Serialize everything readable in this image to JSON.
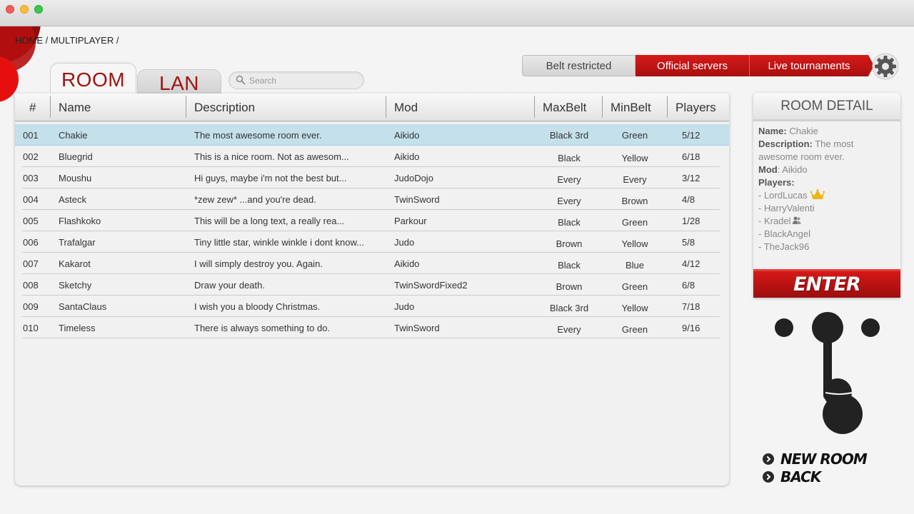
{
  "window": {
    "controls": [
      "close",
      "minimize",
      "zoom"
    ]
  },
  "breadcrumb": "HOME / MULTIPLAYER /",
  "tabs": {
    "room": "ROOM",
    "lan": "LAN"
  },
  "search": {
    "placeholder": "Search",
    "value": ""
  },
  "filters": {
    "belt": "Belt restricted",
    "official": "Official servers",
    "live": "Live tournaments"
  },
  "table": {
    "headers": {
      "num": "#",
      "name": "Name",
      "desc": "Description",
      "mod": "Mod",
      "max": "MaxBelt",
      "min": "MinBelt",
      "players": "Players"
    },
    "rows": [
      {
        "num": "001",
        "name": "Chakie",
        "desc": "The most awesome room ever.",
        "mod": "Aikido",
        "max": "Black 3rd",
        "min": "Green",
        "players": "5/12"
      },
      {
        "num": "002",
        "name": "Bluegrid",
        "desc": "This is a nice room. Not as awesom...",
        "mod": "Aikido",
        "max": "Black",
        "min": "Yellow",
        "players": "6/18"
      },
      {
        "num": "003",
        "name": "Moushu",
        "desc": "Hi guys, maybe i'm not the best but...",
        "mod": "JudoDojo",
        "max": "Every",
        "min": "Every",
        "players": "3/12"
      },
      {
        "num": "004",
        "name": "Asteck",
        "desc": "*zew zew* ...and you're dead.",
        "mod": "TwinSword",
        "max": "Every",
        "min": "Brown",
        "players": "4/8"
      },
      {
        "num": "005",
        "name": "Flashkoko",
        "desc": "This will be a long text, a really rea...",
        "mod": "Parkour",
        "max": "Black",
        "min": "Green",
        "players": "1/28"
      },
      {
        "num": "006",
        "name": "Trafalgar",
        "desc": "Tiny little star, winkle winkle i dont know...",
        "mod": "Judo",
        "max": "Brown",
        "min": "Yellow",
        "players": "5/8"
      },
      {
        "num": "007",
        "name": "Kakarot",
        "desc": "I will simply destroy you. Again.",
        "mod": "Aikido",
        "max": "Black",
        "min": "Blue",
        "players": "4/12"
      },
      {
        "num": "008",
        "name": "Sketchy",
        "desc": "Draw your death.",
        "mod": "TwinSwordFixed2",
        "max": "Brown",
        "min": "Green",
        "players": "6/8"
      },
      {
        "num": "009",
        "name": "SantaClaus",
        "desc": "I wish you a bloody Christmas.",
        "mod": "Judo",
        "max": "Black 3rd",
        "min": "Yellow",
        "players": "7/18"
      },
      {
        "num": "010",
        "name": "Timeless",
        "desc": "There is always something to do.",
        "mod": "TwinSword",
        "max": "Every",
        "min": "Green",
        "players": "9/16"
      }
    ]
  },
  "detail": {
    "title": "ROOM DETAIL",
    "name_label": "Name:",
    "name": "Chakie",
    "desc_label": "Description:",
    "desc": "The most awesome room ever.",
    "mod_label": "Mod",
    "mod": ": Aikido",
    "players_label": "Players:",
    "players": [
      "- LordLucas",
      "- HarryValenti",
      "- Kradel",
      "- BlackAngel",
      "- TheJack96"
    ],
    "enter": "ENTER"
  },
  "menu": {
    "new_room": "NEW ROOM",
    "back": "BACK"
  },
  "colors": {
    "accent": "#c01414",
    "selected_row": "#c4e0ea",
    "crown": "#f0b31a"
  }
}
